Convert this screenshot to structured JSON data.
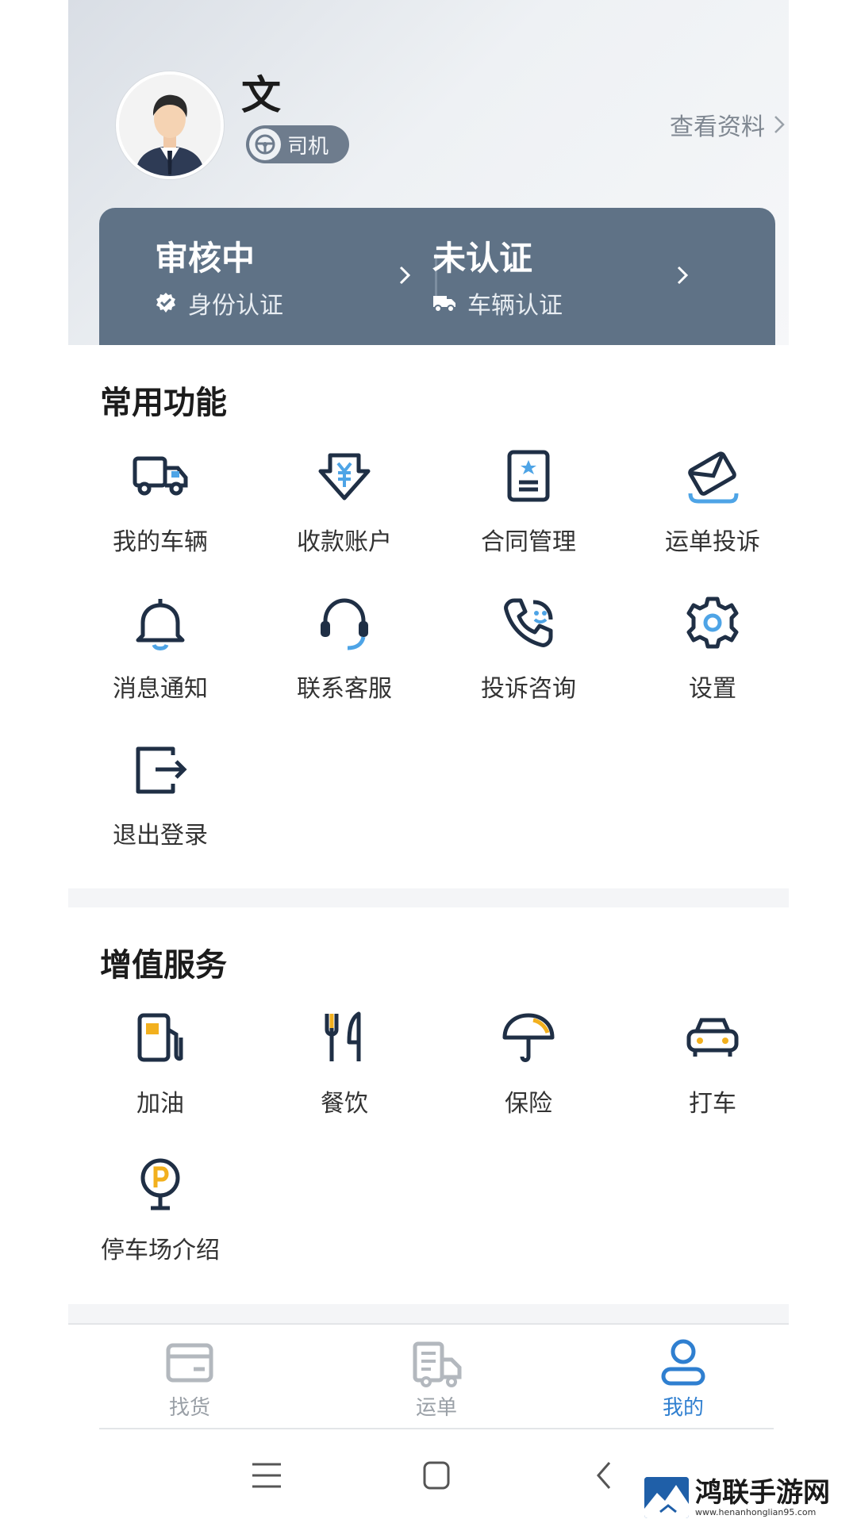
{
  "header": {
    "username": "文",
    "role": "司机",
    "profile_link": "查看资料"
  },
  "certification": [
    {
      "status": "审核中",
      "label": "身份认证"
    },
    {
      "status": "未认证",
      "label": "车辆认证"
    }
  ],
  "common_functions": {
    "title": "常用功能",
    "items": [
      {
        "label": "我的车辆",
        "icon": "truck-icon"
      },
      {
        "label": "收款账户",
        "icon": "yuan-shield-icon"
      },
      {
        "label": "合同管理",
        "icon": "contract-icon"
      },
      {
        "label": "运单投诉",
        "icon": "envelope-icon"
      },
      {
        "label": "消息通知",
        "icon": "bell-icon"
      },
      {
        "label": "联系客服",
        "icon": "headset-icon"
      },
      {
        "label": "投诉咨询",
        "icon": "phone-smile-icon"
      },
      {
        "label": "设置",
        "icon": "gear-icon"
      },
      {
        "label": "退出登录",
        "icon": "logout-icon"
      }
    ]
  },
  "value_services": {
    "title": "增值服务",
    "items": [
      {
        "label": "加油",
        "icon": "fuel-icon"
      },
      {
        "label": "餐饮",
        "icon": "fork-knife-icon"
      },
      {
        "label": "保险",
        "icon": "umbrella-icon"
      },
      {
        "label": "打车",
        "icon": "car-icon"
      },
      {
        "label": "停车场介绍",
        "icon": "parking-icon"
      }
    ]
  },
  "tabbar": {
    "tabs": [
      {
        "label": "找货",
        "icon": "wallet-icon",
        "active": false
      },
      {
        "label": "运单",
        "icon": "clipboard-truck-icon",
        "active": false
      },
      {
        "label": "我的",
        "icon": "user-icon",
        "active": true
      }
    ]
  },
  "watermark": {
    "title": "鸿联手游网",
    "url": "www.henanhonglian95.com"
  },
  "colors": {
    "accent": "#2f7fd0",
    "card": "#5f7286",
    "icon_dark": "#1f2f45",
    "icon_blue": "#4ea4e6",
    "icon_yellow": "#f2b01e"
  }
}
